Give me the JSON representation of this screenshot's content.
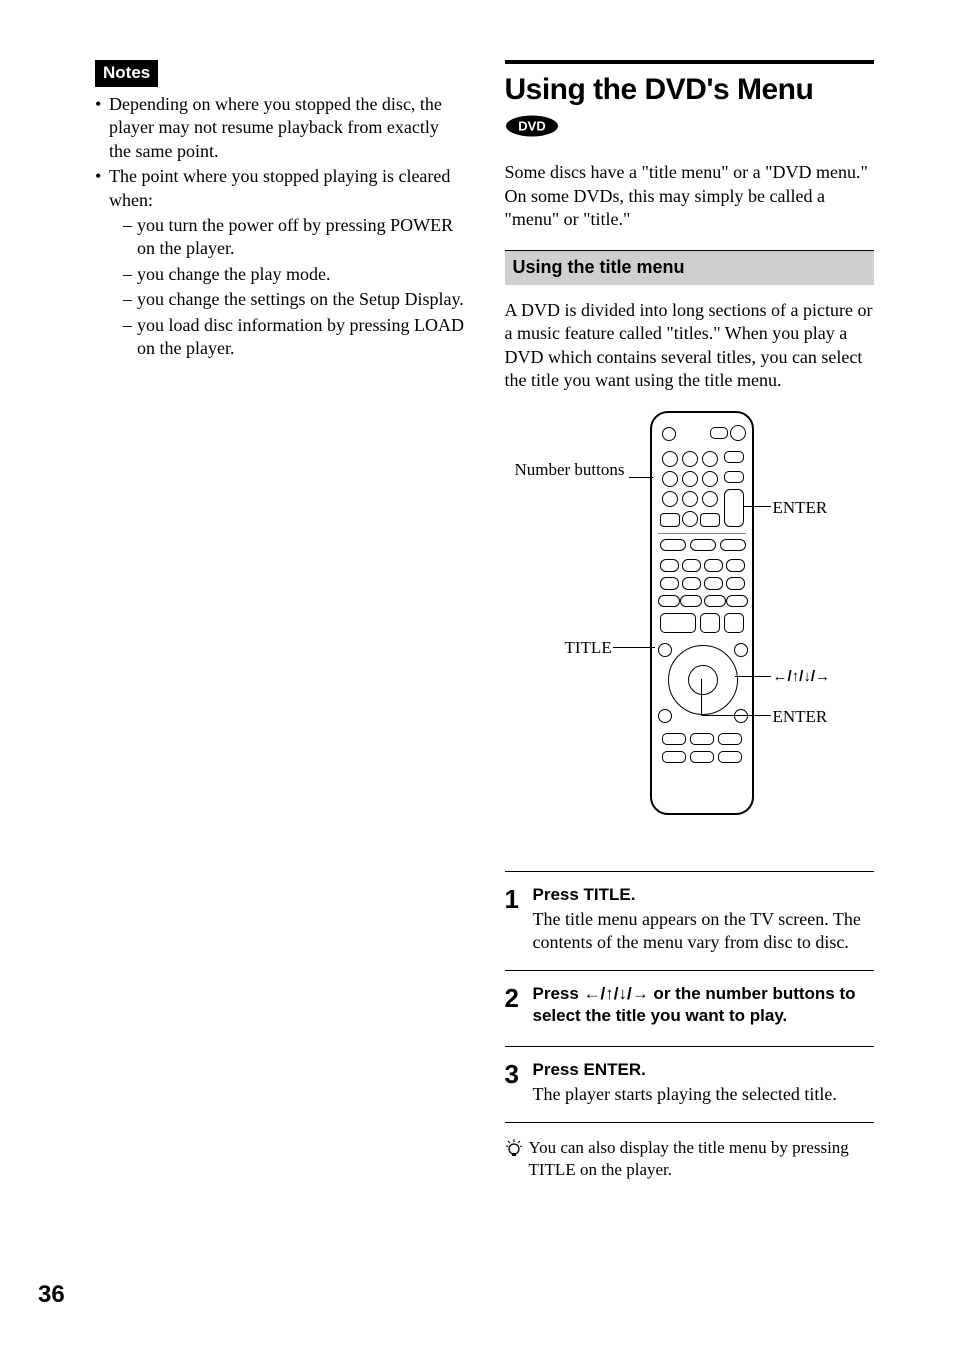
{
  "left": {
    "notes_label": "Notes",
    "bullets": [
      "Depending on where you stopped the disc, the player may not resume playback from exactly the same point.",
      "The point where you stopped playing is cleared when:"
    ],
    "dashes": [
      "you turn the power off by pressing POWER on the player.",
      "you change the play mode.",
      "you change the settings on the Setup Display.",
      "you load disc information by pressing LOAD on the player."
    ]
  },
  "right": {
    "title": "Using the DVD's Menu",
    "dvd_badge": "DVD",
    "intro": "Some discs have a \"title menu\" or a \"DVD menu.\" On some DVDs, this may simply be called a \"menu\" or \"title.\"",
    "subhead": "Using the title menu",
    "sub_intro": "A DVD is divided into long sections of a picture or a music feature called \"titles.\" When you play a DVD which contains several titles, you can select the title you want using the title menu.",
    "remote_labels": {
      "number_buttons": "Number buttons",
      "enter_top": "ENTER",
      "title": "TITLE",
      "arrows": "←/↑/↓/→",
      "enter_bottom": "ENTER"
    },
    "steps": [
      {
        "num": "1",
        "lead": "Press TITLE.",
        "desc": "The title menu appears on the TV screen. The contents of the menu vary from disc to disc."
      },
      {
        "num": "2",
        "lead": "Press ←/↑/↓/→ or the number buttons to select the title you want to play.",
        "desc": ""
      },
      {
        "num": "3",
        "lead": "Press ENTER.",
        "desc": "The player starts playing the selected title."
      }
    ],
    "tip": "You can also display the title menu by pressing TITLE  on the player."
  },
  "page_number": "36"
}
